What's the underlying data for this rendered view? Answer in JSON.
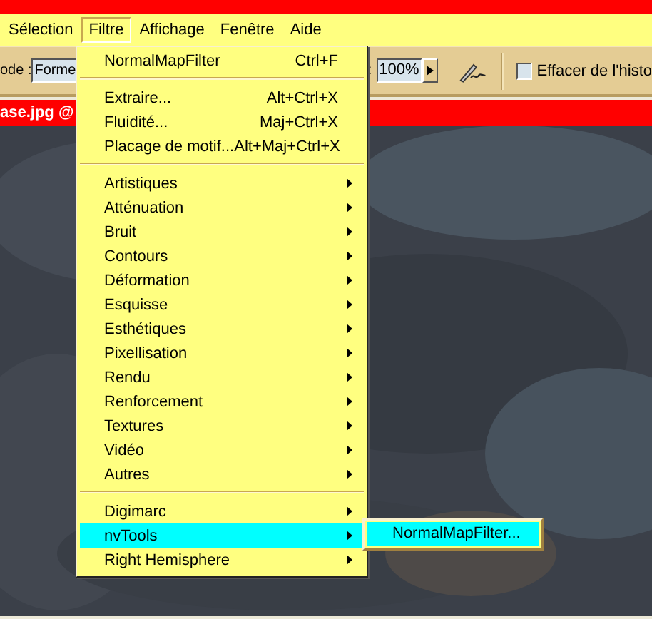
{
  "menu_bar": {
    "items": [
      {
        "label": "Sélection",
        "selected": false
      },
      {
        "label": "Filtre",
        "selected": true
      },
      {
        "label": "Affichage",
        "selected": false
      },
      {
        "label": "Fenêtre",
        "selected": false
      },
      {
        "label": "Aide",
        "selected": false
      }
    ]
  },
  "options_bar": {
    "mode_label": "ode :",
    "mode_field": {
      "value": "Forme"
    },
    "zoom_label": ":",
    "zoom_field": {
      "value": "100%"
    },
    "erase_history": {
      "label": "Effacer de l'histo",
      "checked": false
    }
  },
  "document": {
    "title": "ase.jpg @"
  },
  "filter_menu": {
    "groups": [
      {
        "items": [
          {
            "label": "NormalMapFilter",
            "shortcut": "Ctrl+F",
            "kind": "command",
            "selected": false
          }
        ]
      },
      {
        "items": [
          {
            "label": "Extraire...",
            "shortcut": "Alt+Ctrl+X",
            "kind": "command",
            "selected": false
          },
          {
            "label": "Fluidité...",
            "shortcut": "Maj+Ctrl+X",
            "kind": "command",
            "selected": false
          },
          {
            "label": "Placage de motif...",
            "shortcut": "Alt+Maj+Ctrl+X",
            "kind": "command",
            "selected": false
          }
        ]
      },
      {
        "items": [
          {
            "label": "Artistiques",
            "kind": "submenu",
            "selected": false
          },
          {
            "label": "Atténuation",
            "kind": "submenu",
            "selected": false
          },
          {
            "label": "Bruit",
            "kind": "submenu",
            "selected": false
          },
          {
            "label": "Contours",
            "kind": "submenu",
            "selected": false
          },
          {
            "label": "Déformation",
            "kind": "submenu",
            "selected": false
          },
          {
            "label": "Esquisse",
            "kind": "submenu",
            "selected": false
          },
          {
            "label": "Esthétiques",
            "kind": "submenu",
            "selected": false
          },
          {
            "label": "Pixellisation",
            "kind": "submenu",
            "selected": false
          },
          {
            "label": "Rendu",
            "kind": "submenu",
            "selected": false
          },
          {
            "label": "Renforcement",
            "kind": "submenu",
            "selected": false
          },
          {
            "label": "Textures",
            "kind": "submenu",
            "selected": false
          },
          {
            "label": "Vidéo",
            "kind": "submenu",
            "selected": false
          },
          {
            "label": "Autres",
            "kind": "submenu",
            "selected": false
          }
        ]
      },
      {
        "items": [
          {
            "label": "Digimarc",
            "kind": "submenu",
            "selected": false
          },
          {
            "label": "nvTools",
            "kind": "submenu",
            "selected": true
          },
          {
            "label": "Right Hemisphere",
            "kind": "submenu",
            "selected": false
          }
        ]
      }
    ]
  },
  "submenu": {
    "items": [
      {
        "label": "NormalMapFilter...",
        "selected": true
      }
    ]
  }
}
